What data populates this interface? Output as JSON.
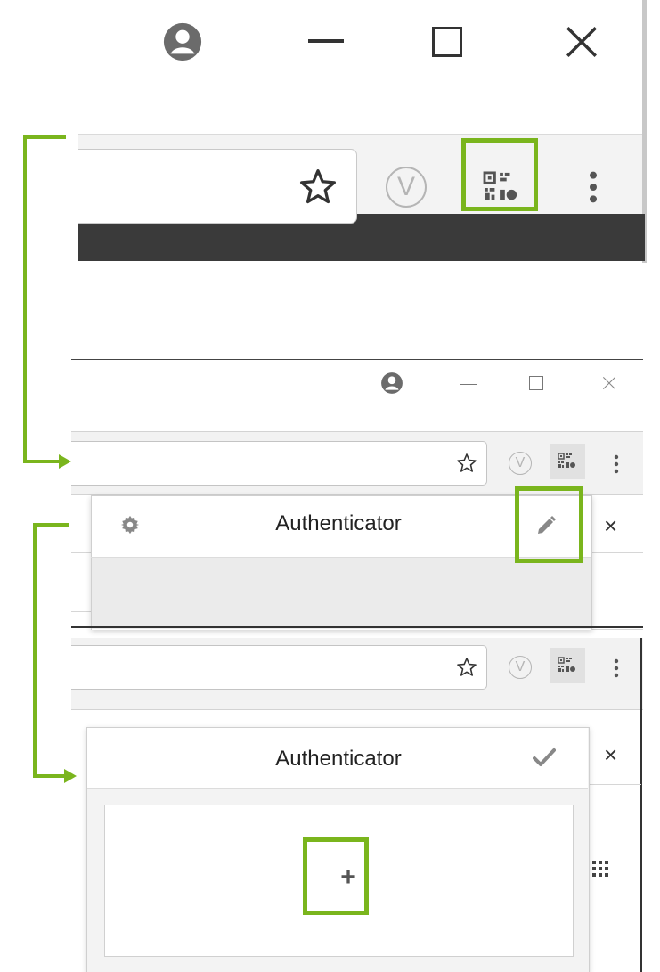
{
  "panel2": {
    "popup_title": "Authenticator",
    "icons": [
      "user-avatar-icon",
      "minimize-icon",
      "maximize-icon",
      "close-icon",
      "star-icon",
      "vivaldi-icon",
      "qr-code-icon",
      "more-menu-icon",
      "gear-icon",
      "pencil-icon",
      "close-icon"
    ],
    "close_glyph": "×"
  },
  "panel3": {
    "popup_title": "Authenticator",
    "add_glyph": "+",
    "close_glyph": "×",
    "icons": [
      "star-icon",
      "vivaldi-icon",
      "qr-code-icon",
      "more-menu-icon",
      "checkmark-icon",
      "plus-icon",
      "apps-grid-icon"
    ]
  },
  "panel1": {
    "icons": [
      "user-avatar-icon",
      "minimize-icon",
      "maximize-icon",
      "close-icon",
      "star-icon",
      "vivaldi-icon",
      "qr-code-icon",
      "more-menu-icon"
    ]
  },
  "vivaldi_glyph": "V",
  "colors": {
    "highlight": "#7ab51d",
    "toolbar": "#f2f2f2",
    "popup_body": "#ebebeb",
    "dark_bar": "#3a3a3a"
  }
}
